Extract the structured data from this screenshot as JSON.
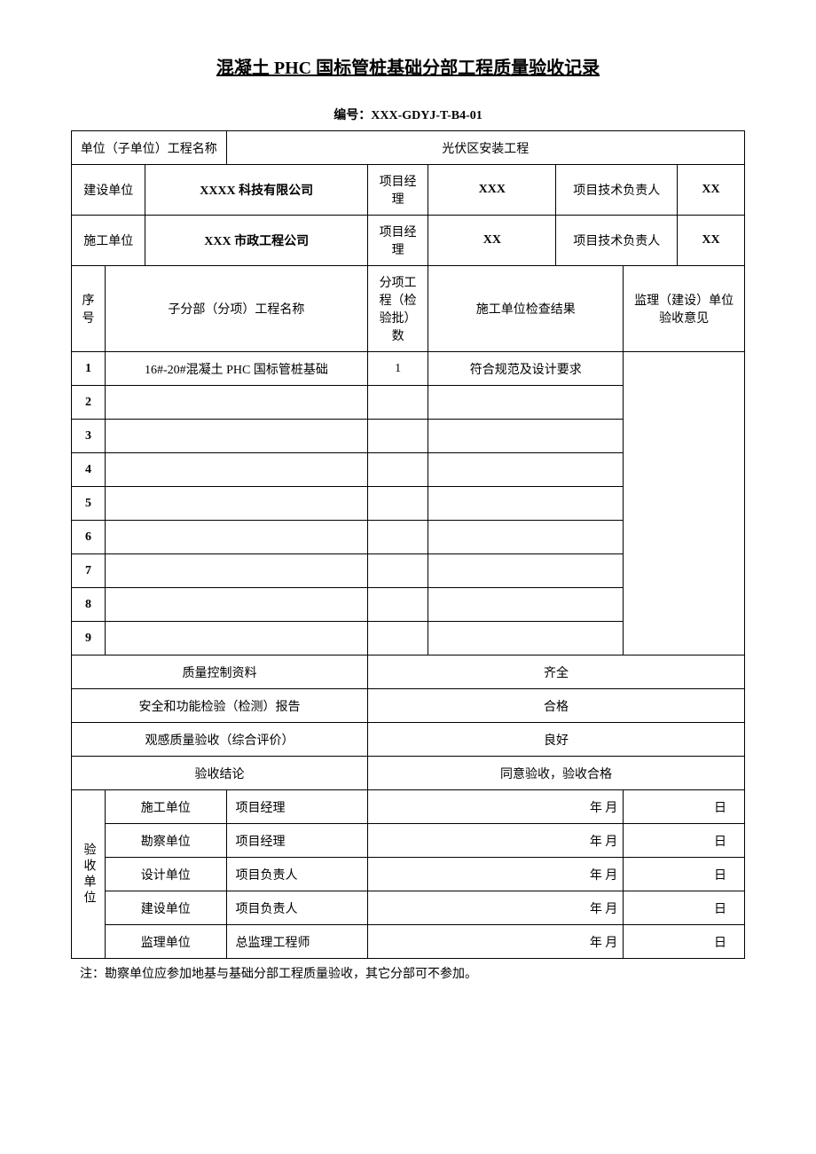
{
  "title": "混凝土 PHC 国标管桩基础分部工程质量验收记录",
  "docnum_label": "编号：",
  "docnum": "XXX-GDYJ-T-B4-01",
  "row_unit_name_label": "单位（子单位）工程名称",
  "row_unit_name_value": "光伏区安装工程",
  "builder_label": "建设单位",
  "builder_value": "XXXX 科技有限公司",
  "pm_label": "项目经理",
  "builder_pm": "XXX",
  "tech_leader_label": "项目技术负责人",
  "builder_tech": "XX",
  "contractor_label": "施工单位",
  "contractor_value": "XXX 市政工程公司",
  "contractor_pm": "XX",
  "contractor_tech": "XX",
  "col_seq": "序号",
  "col_subname": "子分部（分项）工程名称",
  "col_batch": "分项工程（检验批）数",
  "col_result": "施工单位检查结果",
  "col_opinion": "监理（建设）单位验收意见",
  "rows": [
    {
      "n": "1",
      "name": "16#-20#混凝土 PHC 国标管桩基础",
      "batch": "1",
      "result": "符合规范及设计要求"
    },
    {
      "n": "2",
      "name": "",
      "batch": "",
      "result": ""
    },
    {
      "n": "3",
      "name": "",
      "batch": "",
      "result": ""
    },
    {
      "n": "4",
      "name": "",
      "batch": "",
      "result": ""
    },
    {
      "n": "5",
      "name": "",
      "batch": "",
      "result": ""
    },
    {
      "n": "6",
      "name": "",
      "batch": "",
      "result": ""
    },
    {
      "n": "7",
      "name": "",
      "batch": "",
      "result": ""
    },
    {
      "n": "8",
      "name": "",
      "batch": "",
      "result": ""
    },
    {
      "n": "9",
      "name": "",
      "batch": "",
      "result": ""
    }
  ],
  "qc_label": "质量控制资料",
  "qc_value": "齐全",
  "safety_label": "安全和功能检验（检测）报告",
  "safety_value": "合格",
  "visual_label": "观感质量验收（综合评价）",
  "visual_value": "良好",
  "conclusion_label": "验收结论",
  "conclusion_value": "同意验收，验收合格",
  "accept_unit_label": "验收单位",
  "sig_rows": [
    {
      "org": "施工单位",
      "role": "项目经理"
    },
    {
      "org": "勘察单位",
      "role": "项目经理"
    },
    {
      "org": "设计单位",
      "role": "项目负责人"
    },
    {
      "org": "建设单位",
      "role": "项目负责人"
    },
    {
      "org": "监理单位",
      "role": "总监理工程师"
    }
  ],
  "date_ym": "年 月",
  "date_d": "日",
  "note": "注：勘察单位应参加地基与基础分部工程质量验收，其它分部可不参加。"
}
